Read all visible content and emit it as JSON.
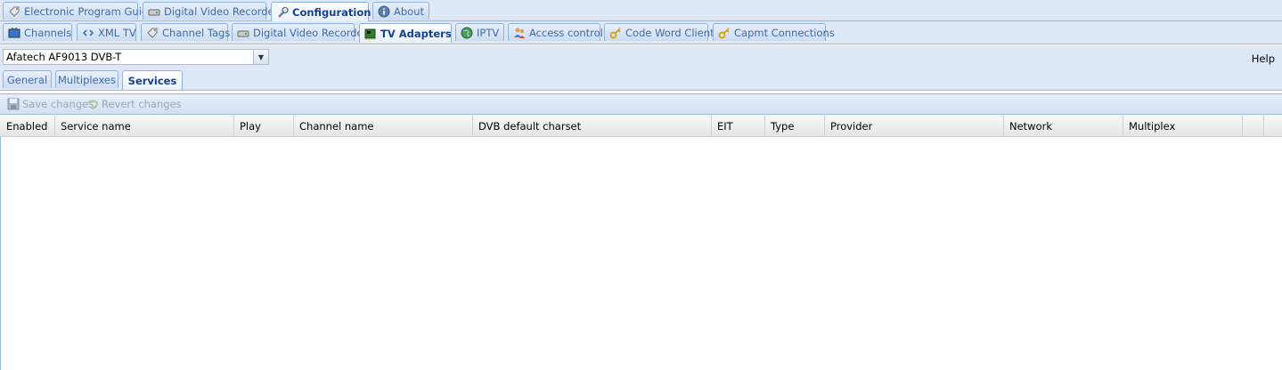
{
  "main_tabs": [
    {
      "label": "Electronic Program Guide",
      "icon": "tag-icon"
    },
    {
      "label": "Digital Video Recorder",
      "icon": "drive-icon"
    },
    {
      "label": "Configuration",
      "icon": "wrench-icon",
      "active": true
    },
    {
      "label": "About",
      "icon": "info-icon"
    }
  ],
  "config_tabs": [
    {
      "label": "Channels",
      "icon": "tv-icon"
    },
    {
      "label": "XML TV",
      "icon": "code-icon"
    },
    {
      "label": "Channel Tags",
      "icon": "tag-icon"
    },
    {
      "label": "Digital Video Recorder",
      "icon": "drive-icon"
    },
    {
      "label": "TV Adapters",
      "icon": "card-icon",
      "active": true
    },
    {
      "label": "IPTV",
      "icon": "globe-icon"
    },
    {
      "label": "Access control",
      "icon": "users-icon"
    },
    {
      "label": "Code Word Client",
      "icon": "key-icon"
    },
    {
      "label": "Capmt Connections",
      "icon": "key-icon"
    }
  ],
  "adapter_select": {
    "value": "Afatech AF9013 DVB-T"
  },
  "help_label": "Help",
  "adapter_tabs": [
    {
      "label": "General"
    },
    {
      "label": "Multiplexes"
    },
    {
      "label": "Services",
      "active": true
    }
  ],
  "toolbar": {
    "save_label": "Save changes",
    "revert_label": "Revert changes"
  },
  "grid_columns": [
    "Enabled",
    "Service name",
    "Play",
    "Channel name",
    "DVB default charset",
    "EIT",
    "Type",
    "Provider",
    "Network",
    "Multiplex"
  ],
  "colors": {
    "tab_border": "#8db2e3",
    "tab_text": "#15428b",
    "strip_bg": "#dfe8f6"
  }
}
